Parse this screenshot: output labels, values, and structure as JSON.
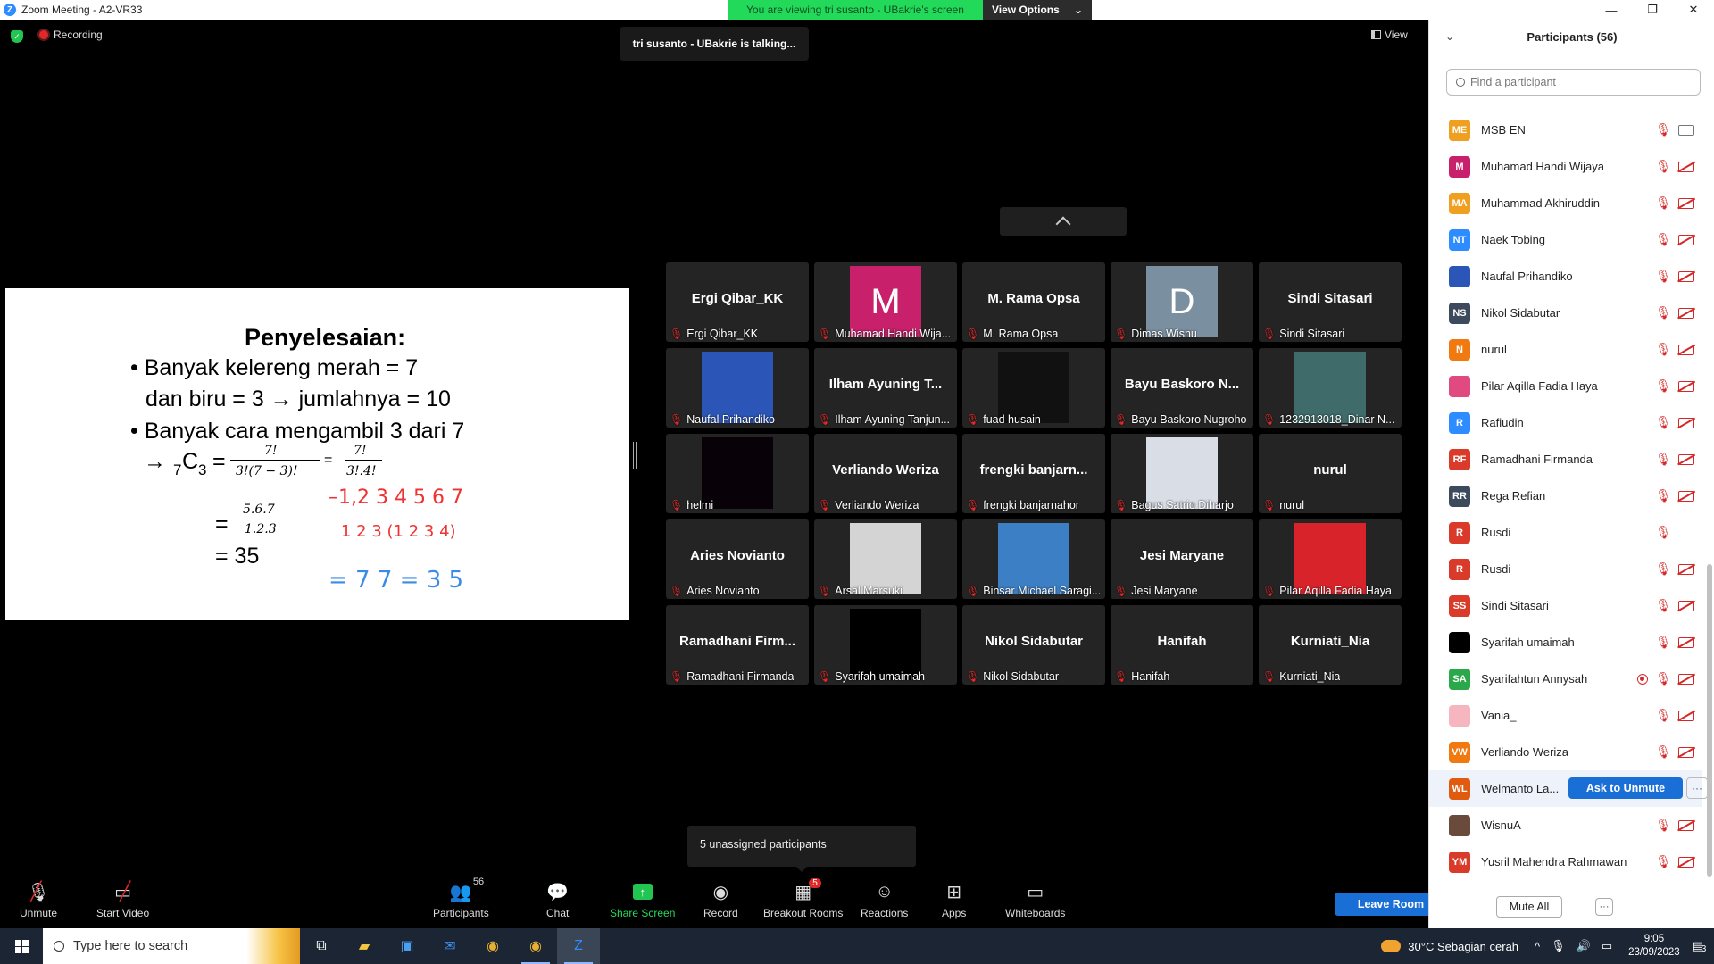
{
  "window": {
    "title": "Zoom Meeting - A2-VR33"
  },
  "share_banner": {
    "text": "You are viewing tri susanto - UBakrie's screen",
    "view_options": "View Options"
  },
  "stage": {
    "recording": "Recording",
    "talking": "tri susanto - UBakrie is talking...",
    "view": "View"
  },
  "slide": {
    "heading": "Penyelesaian:",
    "line1": "• Banyak kelereng merah = 7",
    "line2": "dan biru = 3 → jumlahnya = 10",
    "line3": "• Banyak cara mengambil 3 dari 7",
    "comb_prefix": "→",
    "comb_sub_left": "7",
    "comb_letter": "C",
    "comb_sub_right": "3",
    "eq1": "=",
    "frac1_num": "7!",
    "frac1_den": "3!(7 − 3)!",
    "eq2": "=",
    "frac2_num": "7!",
    "frac2_den": "3!.4!",
    "eq3": "=",
    "frac3_num": "5.6.7",
    "frac3_den": "1.2.3",
    "result": "= 35",
    "hand1": "–1,2 3 4 5 6 7",
    "hand2": "1 2 3 (1 2 3 4)",
    "hand3": "= 7 7 = 3 5"
  },
  "gallery": [
    {
      "big": "Ergi Qibar_KK",
      "label": "Ergi Qibar_KK",
      "avatar": ""
    },
    {
      "big": "",
      "label": "Muhamad Handi Wija...",
      "avatar": "M",
      "avatar_color": "#c8206a"
    },
    {
      "big": "M. Rama Opsa",
      "label": "M. Rama Opsa",
      "avatar": ""
    },
    {
      "big": "",
      "label": "Dimas Wisnu",
      "avatar": "D",
      "avatar_color": "#7a8fa0"
    },
    {
      "big": "Sindi Sitasari",
      "label": "Sindi Sitasari",
      "avatar": ""
    },
    {
      "big": "",
      "label": "Naufal Prihandiko",
      "avatar": "photo",
      "avatar_color": "#2b56b8"
    },
    {
      "big": "Ilham Ayuning T...",
      "label": "Ilham Ayuning Tanjun...",
      "avatar": ""
    },
    {
      "big": "",
      "label": "fuad husain",
      "avatar": "photo",
      "avatar_color": "#111111"
    },
    {
      "big": "Bayu Baskoro N...",
      "label": "Bayu Baskoro Nugroho",
      "avatar": ""
    },
    {
      "big": "",
      "label": "1232913018_Dinar N...",
      "avatar": "photo",
      "avatar_color": "#3f6b6a"
    },
    {
      "big": "",
      "label": "helmi",
      "avatar": "photo",
      "avatar_color": "#080208"
    },
    {
      "big": "Verliando Weriza",
      "label": "Verliando Weriza",
      "avatar": ""
    },
    {
      "big": "frengki  banjarn...",
      "label": "frengki banjarnahor",
      "avatar": ""
    },
    {
      "big": "",
      "label": "Bagus Satrio Diharjo",
      "avatar": "photo",
      "avatar_color": "#d8dde6"
    },
    {
      "big": "nurul",
      "label": "nurul",
      "avatar": ""
    },
    {
      "big": "Aries Novianto",
      "label": "Aries Novianto",
      "avatar": ""
    },
    {
      "big": "",
      "label": "Arsal Marsuki",
      "avatar": "photo",
      "avatar_color": "#d4d4d4"
    },
    {
      "big": "",
      "label": "Binsar Michael Saragi...",
      "avatar": "photo",
      "avatar_color": "#3d7fc4"
    },
    {
      "big": "Jesi Maryane",
      "label": "Jesi Maryane",
      "avatar": ""
    },
    {
      "big": "",
      "label": "Pilar Aqilla Fadia Haya",
      "avatar": "photo",
      "avatar_color": "#d8232a"
    },
    {
      "big": "Ramadhani  Firm...",
      "label": "Ramadhani Firmanda",
      "avatar": ""
    },
    {
      "big": "",
      "label": "Syarifah umaimah",
      "avatar": "photo",
      "avatar_color": "#000000"
    },
    {
      "big": "Nikol Sidabutar",
      "label": "Nikol Sidabutar",
      "avatar": ""
    },
    {
      "big": "Hanifah",
      "label": "Hanifah",
      "avatar": ""
    },
    {
      "big": "Kurniati_Nia",
      "label": "Kurniati_Nia",
      "avatar": ""
    }
  ],
  "unassigned": "5 unassigned participants",
  "toolbar": {
    "unmute": "Unmute",
    "start_video": "Start Video",
    "participants": "Participants",
    "participants_count": "56",
    "chat": "Chat",
    "share_screen": "Share Screen",
    "record": "Record",
    "breakout": "Breakout Rooms",
    "breakout_badge": "5",
    "reactions": "Reactions",
    "apps": "Apps",
    "whiteboards": "Whiteboards",
    "leave": "Leave Room"
  },
  "panel": {
    "title": "Participants (56)",
    "search_placeholder": "Find a participant",
    "mute_all": "Mute All",
    "ask_to_unmute": "Ask to Unmute",
    "participants": [
      {
        "initials": "ME",
        "name": "MSB EN",
        "color": "#f0a020",
        "video": "on"
      },
      {
        "initials": "M",
        "name": "Muhamad Handi Wijaya",
        "color": "#c8206a",
        "video": "off"
      },
      {
        "initials": "MA",
        "name": "Muhammad Akhiruddin",
        "color": "#f0a020",
        "video": "off"
      },
      {
        "initials": "NT",
        "name": "Naek Tobing",
        "color": "#2d8cff",
        "video": "off"
      },
      {
        "initials": "",
        "name": "Naufal Prihandiko",
        "color": "#2b56b8",
        "video": "off"
      },
      {
        "initials": "NS",
        "name": "Nikol Sidabutar",
        "color": "#3d4a5c",
        "video": "off"
      },
      {
        "initials": "N",
        "name": "nurul",
        "color": "#f07a10",
        "video": "off"
      },
      {
        "initials": "",
        "name": "Pilar Aqilla Fadia Haya",
        "color": "#e04a80",
        "video": "off"
      },
      {
        "initials": "R",
        "name": "Rafiudin",
        "color": "#2d8cff",
        "video": "off"
      },
      {
        "initials": "RF",
        "name": "Ramadhani Firmanda",
        "color": "#d93a2a",
        "video": "off"
      },
      {
        "initials": "RR",
        "name": "Rega Refian",
        "color": "#3d4a5c",
        "video": "off"
      },
      {
        "initials": "R",
        "name": "Rusdi",
        "color": "#d93a2a",
        "video": "none"
      },
      {
        "initials": "R",
        "name": "Rusdi",
        "color": "#d93a2a",
        "video": "off"
      },
      {
        "initials": "SS",
        "name": "Sindi Sitasari",
        "color": "#d93a2a",
        "video": "off"
      },
      {
        "initials": "",
        "name": "Syarifah umaimah",
        "color": "#000000",
        "video": "off"
      },
      {
        "initials": "SA",
        "name": "Syarifahtun Annysah",
        "color": "#2aa84a",
        "video": "off",
        "rec": true
      },
      {
        "initials": "",
        "name": "Vania_",
        "color": "#f5b6c0",
        "video": "off"
      },
      {
        "initials": "VW",
        "name": "Verliando Weriza",
        "color": "#f07a10",
        "video": "off"
      },
      {
        "initials": "WL",
        "name": "Welmanto La...",
        "color": "#e05a10",
        "video": "ask"
      },
      {
        "initials": "",
        "name": "WisnuA",
        "color": "#6a4a3a",
        "video": "off"
      },
      {
        "initials": "YM",
        "name": "Yusril Mahendra Rahmawan",
        "color": "#d93a2a",
        "video": "off"
      }
    ]
  },
  "taskbar": {
    "search_placeholder": "Type here to search",
    "weather": "30°C  Sebagian cerah",
    "time": "9:05",
    "date": "23/09/2023",
    "notif_count": "3"
  }
}
